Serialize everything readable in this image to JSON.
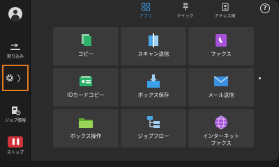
{
  "sidebar": {
    "interrupt_label": "割り込み",
    "jobs_label": "ジョブ情報",
    "stop_label": "ストップ",
    "settings_chevron": "〉"
  },
  "tabs": [
    {
      "label": "アプリ",
      "active": true
    },
    {
      "label": "クイック",
      "active": false
    },
    {
      "label": "アドレス帳",
      "active": false
    }
  ],
  "help_label": "?",
  "apps": [
    {
      "label": "コピー",
      "icon": "copy-icon"
    },
    {
      "label": "スキャン送信",
      "icon": "scan-send-icon"
    },
    {
      "label": "ファクス",
      "icon": "fax-icon"
    },
    {
      "label": "IDカードコピー",
      "icon": "id-card-copy-icon"
    },
    {
      "label": "ボックス保存",
      "icon": "box-save-icon"
    },
    {
      "label": "メール送信",
      "icon": "email-send-icon"
    },
    {
      "label": "ボックス操作",
      "icon": "box-operation-icon"
    },
    {
      "label": "ジョブフロー",
      "icon": "job-flow-icon"
    },
    {
      "label": "インターネット\nファクス",
      "icon": "internet-fax-icon"
    }
  ],
  "colors": {
    "accent": "#3b9be8",
    "highlight": "#e57b1f",
    "stop": "#d2333a"
  }
}
